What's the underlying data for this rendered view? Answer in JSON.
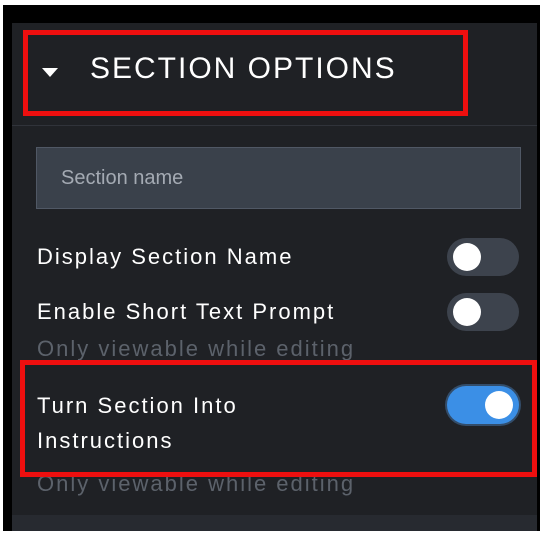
{
  "section": {
    "title": "SECTION OPTIONS",
    "name_placeholder": "Section name",
    "name_value": "",
    "options": [
      {
        "label": "Display Section Name",
        "enabled": false
      },
      {
        "label": "Enable Short Text Prompt",
        "enabled": false,
        "note": "Only viewable while editing"
      },
      {
        "label_line1": "Turn Section Into",
        "label_line2": "Instructions",
        "enabled": true,
        "note": "Only viewable while editing"
      }
    ]
  },
  "colors": {
    "panel_bg": "#1f2125",
    "highlight_red": "#ee0f0f",
    "toggle_on": "#3b8fe6",
    "toggle_off": "#3d434d"
  }
}
